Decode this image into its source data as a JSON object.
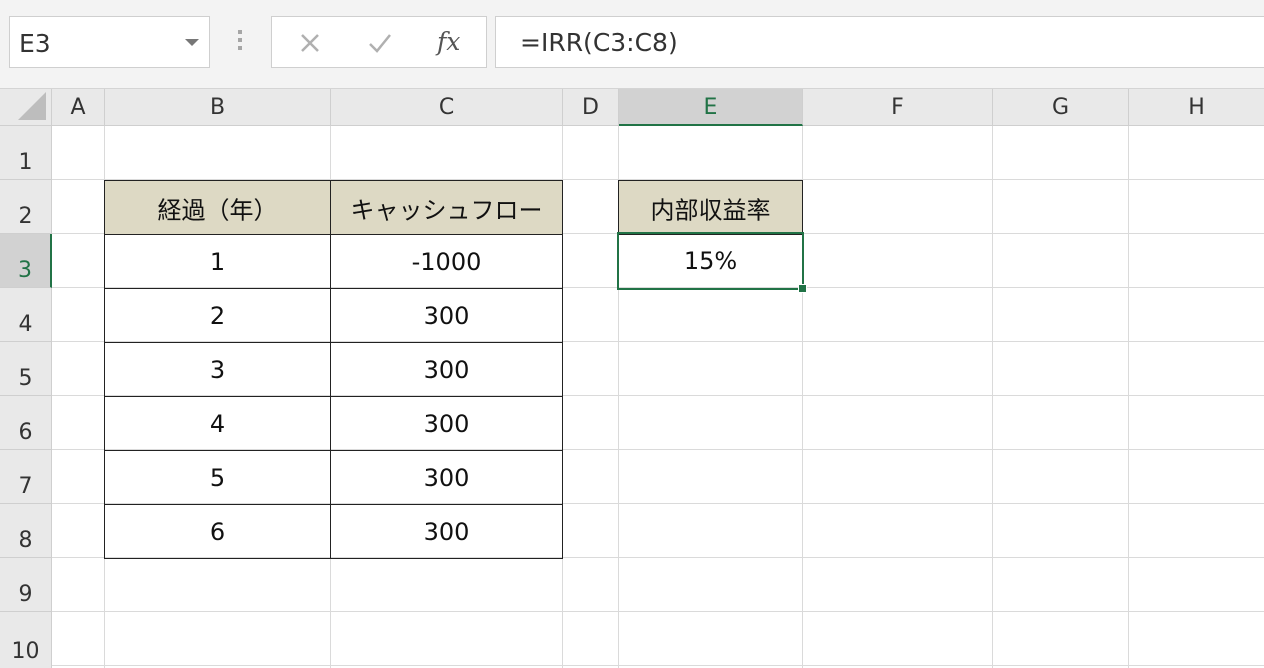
{
  "name_box": {
    "value": "E3"
  },
  "formula_bar": {
    "cancel_icon": "close-icon",
    "enter_icon": "check-icon",
    "fx_label": "fx",
    "formula": "=IRR(C3:C8)"
  },
  "columns": [
    "A",
    "B",
    "C",
    "D",
    "E",
    "F",
    "G",
    "H"
  ],
  "rows": [
    "1",
    "2",
    "3",
    "4",
    "5",
    "6",
    "7",
    "8",
    "9",
    "10"
  ],
  "active_cell": {
    "column": "E",
    "row": "3"
  },
  "table": {
    "headers": {
      "elapsed": "経過（年）",
      "cashflow": "キャッシュフロー"
    },
    "rows": [
      {
        "year": "1",
        "cashflow": "-1000"
      },
      {
        "year": "2",
        "cashflow": "300"
      },
      {
        "year": "3",
        "cashflow": "300"
      },
      {
        "year": "4",
        "cashflow": "300"
      },
      {
        "year": "5",
        "cashflow": "300"
      },
      {
        "year": "6",
        "cashflow": "300"
      }
    ]
  },
  "irr": {
    "label": "内部収益率",
    "value": "15%"
  },
  "colors": {
    "header_fill": "#ddd9c4",
    "selection": "#217346"
  }
}
